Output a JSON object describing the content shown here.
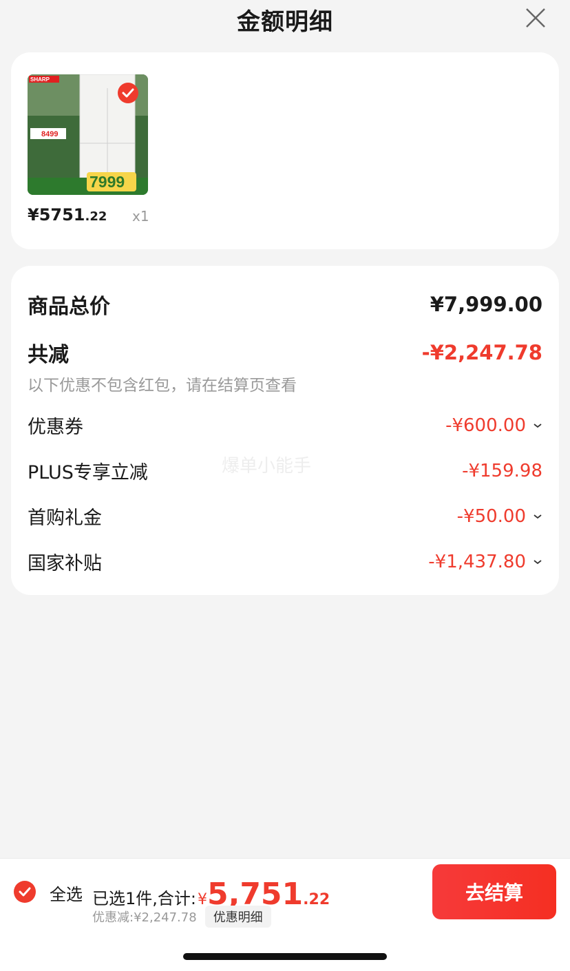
{
  "header": {
    "title": "金额明细"
  },
  "product": {
    "brand_text": "SHARP",
    "promo_price_text": "7999",
    "price_int": "¥5751",
    "price_dec": ".22",
    "quantity": "x1"
  },
  "summary": {
    "total_label": "商品总价",
    "total_value": "¥7,999.00",
    "reduce_label": "共减",
    "reduce_value": "-¥2,247.78",
    "hint": "以下优惠不包含红包，请在结算页查看",
    "items": [
      {
        "label": "优惠券",
        "value": "-¥600.00",
        "expandable": true
      },
      {
        "label": "PLUS专享立减",
        "value": "-¥159.98",
        "expandable": false
      },
      {
        "label": "首购礼金",
        "value": "-¥50.00",
        "expandable": true
      },
      {
        "label": "国家补贴",
        "value": "-¥1,437.80",
        "expandable": true
      }
    ]
  },
  "watermark": "爆单小能手",
  "bottom_bar": {
    "select_all_label": "全选",
    "selected_text": "已选1件,合计:",
    "currency": "¥",
    "total_int": "5,751",
    "total_dec": ".22",
    "discount_text": "优惠减:¥2,247.78",
    "detail_button": "优惠明细",
    "checkout_button": "去结算"
  },
  "colors": {
    "accent_red": "#ef3b2d",
    "button_red": "#f63a3a",
    "background": "#f4f4f4"
  },
  "icons": [
    "close-icon",
    "check-circle-icon",
    "chevron-down-icon"
  ]
}
